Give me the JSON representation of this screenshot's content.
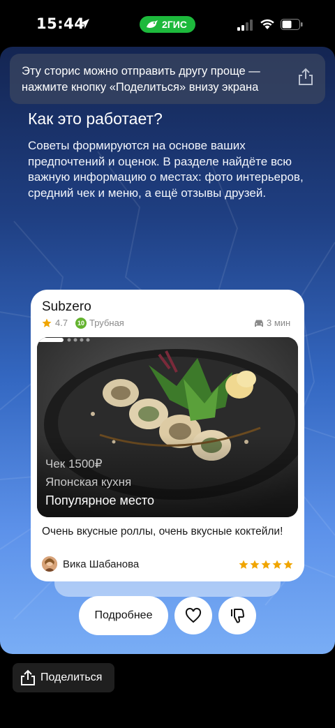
{
  "status_bar": {
    "time": "15:44",
    "app_name": "2ГИС",
    "app_color": "#1db93c"
  },
  "story": {
    "toast": {
      "text": "Эту сторис можно отправить другу проще — нажмите кнопку «Поделиться» внизу экрана",
      "icon": "share-icon"
    },
    "heading": "Как это работает?",
    "body": "Советы формируются на основе ваших предпочтений и оценок. В разделе найдёте всю важную информацию о местах: фото интерьеров, средний чек и меню, а ещё отзывы друзей."
  },
  "card": {
    "title": "Subzero",
    "rating": "4.7",
    "metro_line": "10",
    "metro_color": "#64b32f",
    "metro_station": "Трубная",
    "travel_time": "3 мин",
    "photo": {
      "price": "Чек 1500₽",
      "cuisine": "Японская кухня",
      "badge": "Популярное место",
      "page_index": 1,
      "page_count": 5
    },
    "review": "Очень вкусные роллы, очень вкусные коктейли!",
    "author": "Вика Шабанова",
    "review_stars": 5,
    "star_color": "#f0a500"
  },
  "actions": {
    "more_label": "Подробнее",
    "like_icon": "heart-icon",
    "dislike_icon": "thumbs-down-icon"
  },
  "share_button": {
    "label": "Поделиться",
    "icon": "share-icon"
  }
}
